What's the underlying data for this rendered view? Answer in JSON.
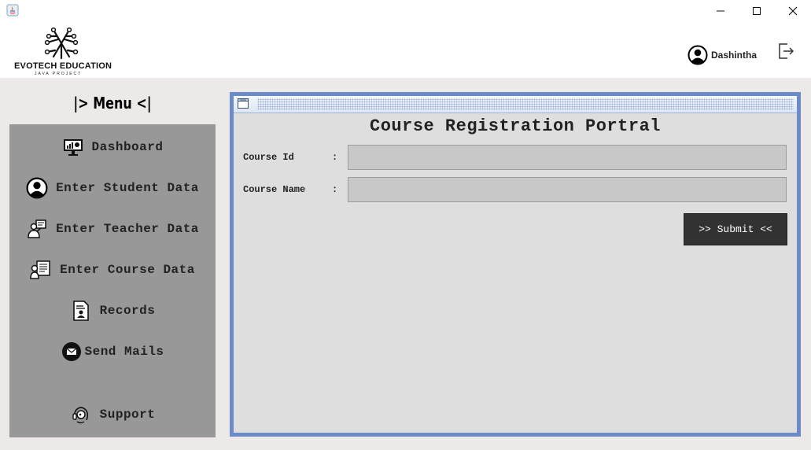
{
  "window": {
    "app_icon": "java-icon",
    "controls": [
      "minimize-icon",
      "maximize-icon",
      "close-icon"
    ]
  },
  "header": {
    "logo_title": "EVOTECH EDUCATION",
    "logo_subtitle": "JAVA PROJECT",
    "user_name": "Dashintha",
    "user_icon": "user-circle-icon",
    "logout_icon": "logout-icon"
  },
  "menu": {
    "title": "|> Menu <|",
    "items": [
      {
        "label": "Dashboard",
        "icon": "monitor-chart-icon"
      },
      {
        "label": "Enter Student Data",
        "icon": "user-circle-icon"
      },
      {
        "label": "Enter Teacher Data",
        "icon": "teacher-icon"
      },
      {
        "label": "Enter Course Data",
        "icon": "course-icon"
      },
      {
        "label": "Records",
        "icon": "records-icon"
      },
      {
        "label": "Send Mails",
        "icon": "mail-icon"
      },
      {
        "label": "Support",
        "icon": "headset-icon"
      }
    ]
  },
  "form": {
    "title": "Course Registration Portral",
    "fields": [
      {
        "label": "Course Id",
        "colon": ":",
        "value": ""
      },
      {
        "label": "Course Name",
        "colon": ":",
        "value": ""
      }
    ],
    "submit_label": ">> Submit <<"
  },
  "colors": {
    "sidebar": "#999898",
    "frame_border": "#6b8cc7",
    "button": "#323232",
    "content_bg": "#ede9e8"
  }
}
